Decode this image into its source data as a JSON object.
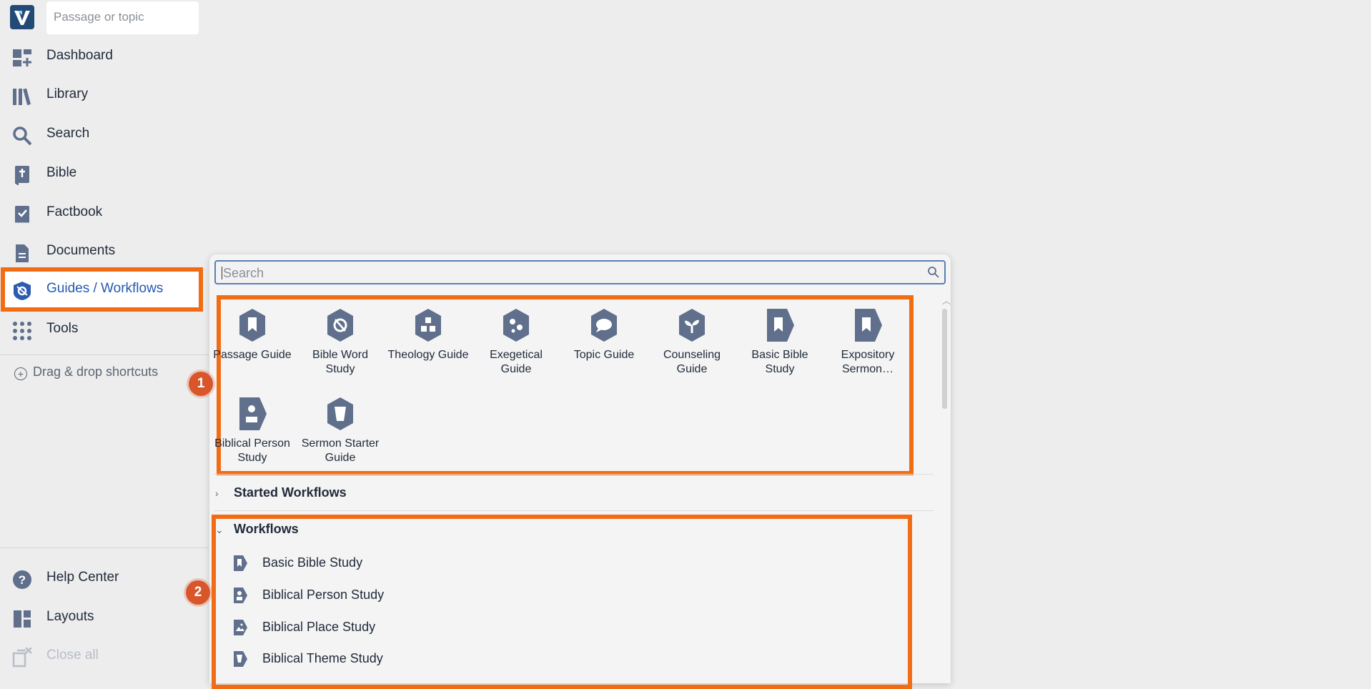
{
  "app": {
    "logo_icon": "logos-v-logo-icon",
    "search_placeholder": "Passage or topic"
  },
  "sidebar": {
    "items": [
      {
        "label": "Dashboard",
        "icon": "dashboard-icon"
      },
      {
        "label": "Library",
        "icon": "library-icon"
      },
      {
        "label": "Search",
        "icon": "search-icon"
      },
      {
        "label": "Bible",
        "icon": "bible-icon"
      },
      {
        "label": "Factbook",
        "icon": "factbook-icon"
      },
      {
        "label": "Documents",
        "icon": "documents-icon"
      },
      {
        "label": "Guides / Workflows",
        "icon": "guides-icon",
        "active": true
      },
      {
        "label": "Tools",
        "icon": "tools-grid-icon"
      }
    ],
    "drag_drop": "Drag & drop shortcuts",
    "bottom_items": [
      {
        "label": "Help Center",
        "icon": "help-icon"
      },
      {
        "label": "Layouts",
        "icon": "layouts-icon"
      },
      {
        "label": "Close all",
        "icon": "close-all-icon",
        "disabled": true
      }
    ]
  },
  "popup": {
    "search_placeholder": "Search",
    "guides": [
      {
        "label": "Passage Guide",
        "icon": "bookmark-icon"
      },
      {
        "label": "Bible Word Study",
        "icon": "word-study-icon"
      },
      {
        "label": "Theology Guide",
        "icon": "theology-icon"
      },
      {
        "label": "Exegetical Guide",
        "icon": "exegetical-icon"
      },
      {
        "label": "Topic Guide",
        "icon": "speech-bubble-icon"
      },
      {
        "label": "Counseling Guide",
        "icon": "sprout-icon"
      },
      {
        "label": "Basic Bible Study",
        "icon": "bookmark-icon"
      },
      {
        "label": "Expository Sermon…",
        "icon": "bookmark-icon"
      },
      {
        "label": "Biblical Person Study",
        "icon": "person-icon"
      },
      {
        "label": "Sermon Starter Guide",
        "icon": "cup-icon"
      }
    ],
    "started_workflows": "Started Workflows",
    "workflows_title": "Workflows",
    "workflows": [
      {
        "label": "Basic Bible Study",
        "icon": "bookmark-icon"
      },
      {
        "label": "Biblical Person Study",
        "icon": "person-icon"
      },
      {
        "label": "Biblical Place Study",
        "icon": "landscape-icon"
      },
      {
        "label": "Biblical Theme Study",
        "icon": "cup-icon"
      }
    ]
  },
  "annotations": {
    "badge_1": "1",
    "badge_2": "2"
  },
  "colors": {
    "highlight": "#f26c14",
    "badge": "#d9562b",
    "icon": "#5f6f8c",
    "active_text": "#2559b0"
  }
}
